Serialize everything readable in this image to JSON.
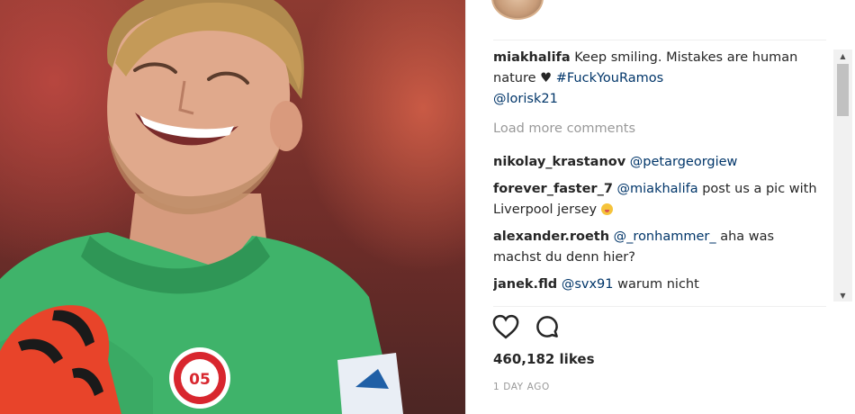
{
  "post": {
    "caption": {
      "user": "miakhalifa",
      "text_1": " Keep smiling. Mistakes are human nature ",
      "heart": "♥",
      "hashtag": "#FuckYouRamos",
      "mention": "@lorisk21"
    },
    "load_more": "Load more comments",
    "comments": [
      {
        "user": "nikolay_krastanov",
        "mention": "@petargeorgiew",
        "text": ""
      },
      {
        "user": "forever_faster_7",
        "mention": "@miakhalifa",
        "text": " post us a pic with Liverpool jersey "
      },
      {
        "user": "alexander.roeth",
        "mention": "@_ronhammer_",
        "text": " aha was machst du denn hier?"
      },
      {
        "user": "janek.fld",
        "mention": "@svx91",
        "text": " warum nicht"
      }
    ],
    "likes": "460,182 likes",
    "time": "1 DAY AGO"
  },
  "icons": {
    "like": "heart-icon",
    "comment": "comment-bubble-icon",
    "emoji": "laughing-emoji-icon",
    "scroll_up": "arrow-up-icon",
    "scroll_down": "arrow-down-icon"
  },
  "colors": {
    "jersey": "#3fb36a",
    "link": "#003569",
    "muted": "#999999",
    "glove": "#e8442a"
  }
}
